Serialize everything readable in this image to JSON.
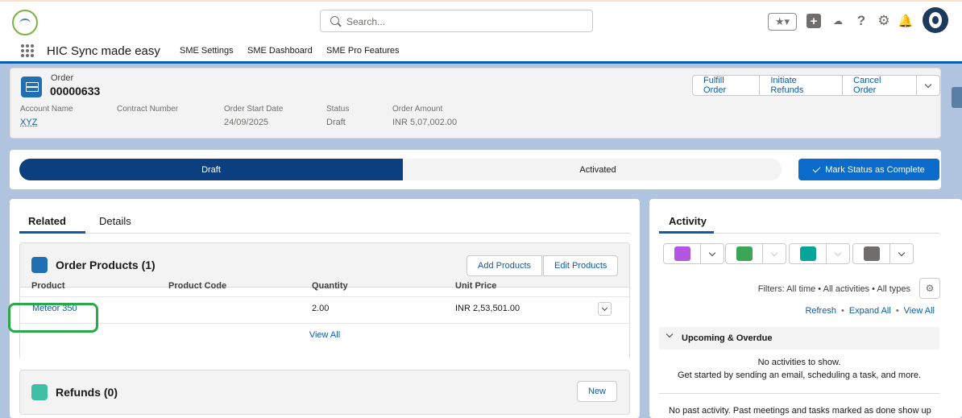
{
  "header": {
    "search_placeholder": "Search...",
    "app_name": "HIC Sync made easy",
    "nav": [
      "SME Settings",
      "SME Dashboard",
      "SME Pro Features"
    ],
    "help_glyph": "?",
    "fav_glyph": "★▾",
    "plus_glyph": "+",
    "trail_glyph": "☁",
    "gear_glyph": "⚙",
    "bell_glyph": "🔔"
  },
  "record": {
    "object_label": "Order",
    "name": "00000633",
    "actions": [
      "Fulfill Order",
      "Initiate Refunds",
      "Cancel Order"
    ],
    "fields": [
      {
        "label": "Account Name",
        "value": "XYZ"
      },
      {
        "label": "Contract Number",
        "value": ""
      },
      {
        "label": "Order Start Date",
        "value": "24/09/2025"
      },
      {
        "label": "Status",
        "value": "Draft"
      },
      {
        "label": "Order Amount",
        "value": "INR 5,07,002.00"
      }
    ]
  },
  "path": {
    "stages": [
      "Draft",
      "Activated"
    ],
    "current_stage": "Draft",
    "mark_button": "Mark Status as Complete"
  },
  "tabs": [
    "Related",
    "Details"
  ],
  "order_products": {
    "title": "Order Products (1)",
    "buttons": [
      "Add Products",
      "Edit Products"
    ],
    "columns": [
      "Product",
      "Product Code",
      "Quantity",
      "Unit Price"
    ],
    "rows": [
      {
        "product": "Meteor 350",
        "code": "",
        "quantity": "2.00",
        "unit_price": "INR 2,53,501.00"
      }
    ],
    "view_all": "View All"
  },
  "refunds": {
    "title": "Refunds (0)",
    "new_button": "New"
  },
  "activity": {
    "title": "Activity",
    "filters": "Filters: All time • All activities • All types",
    "links": [
      "Refresh",
      "Expand All",
      "View All"
    ],
    "link_sep": "•",
    "upcoming_label": "Upcoming & Overdue",
    "empty_line1": "No activities to show.",
    "empty_line2": "Get started by sending an email, scheduling a task, and more.",
    "past_text": "No past activity. Past meetings and tasks marked as done show up",
    "publisher_colors": [
      "#b556e0",
      "#3ba755",
      "#06a59a",
      "#706e6b"
    ]
  },
  "colors": {
    "brand": "#0b5cab",
    "path_active": "#0b3f80",
    "highlight": "#2aa84a"
  }
}
